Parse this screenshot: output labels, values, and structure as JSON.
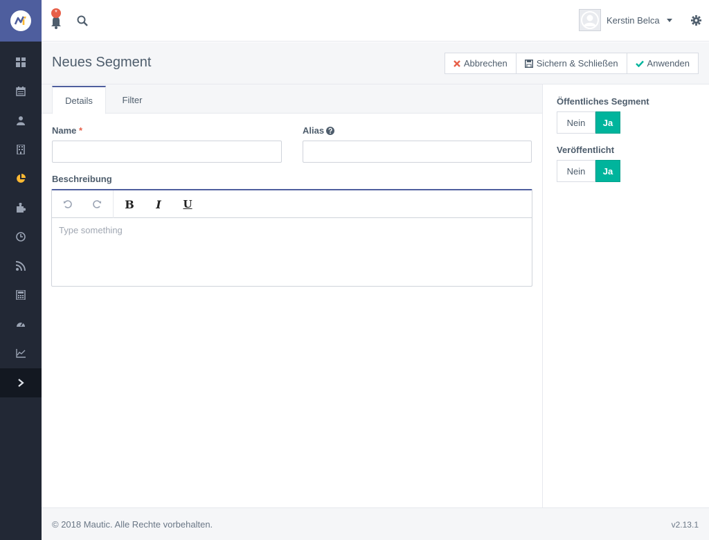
{
  "sidebar": {
    "logo_icon": "mautic-logo-icon",
    "items": [
      {
        "icon": "dashboard-icon"
      },
      {
        "icon": "calendar-icon"
      },
      {
        "icon": "contacts-icon"
      },
      {
        "icon": "companies-icon"
      },
      {
        "icon": "segments-icon",
        "active": true,
        "color": "#fdb933"
      },
      {
        "icon": "components-icon"
      },
      {
        "icon": "campaigns-icon"
      },
      {
        "icon": "channels-icon"
      },
      {
        "icon": "points-icon"
      },
      {
        "icon": "stages-icon"
      },
      {
        "icon": "reports-icon"
      }
    ],
    "expand_icon": "chevron-right-icon"
  },
  "topbar": {
    "notification_badge": "*",
    "user_name": "Kerstin Belca"
  },
  "header": {
    "title": "Neues Segment",
    "buttons": {
      "cancel": "Abbrechen",
      "save_close": "Sichern & Schließen",
      "apply": "Anwenden"
    }
  },
  "tabs": [
    {
      "label": "Details",
      "active": true
    },
    {
      "label": "Filter",
      "active": false
    }
  ],
  "form": {
    "name_label": "Name",
    "name_required": "*",
    "name_value": "",
    "alias_label": "Alias",
    "alias_value": "",
    "description_label": "Beschreibung",
    "editor_placeholder": "Type something",
    "toolbar": {
      "bold": "B",
      "italic": "I",
      "underline": "U"
    }
  },
  "right_panel": {
    "public_label": "Öffentliches Segment",
    "public_no": "Nein",
    "public_yes": "Ja",
    "published_label": "Veröffentlicht",
    "published_no": "Nein",
    "published_yes": "Ja",
    "toggle_active_color": "#00b49c"
  },
  "footer": {
    "copyright": "© 2018 Mautic. Alle Rechte vorbehalten.",
    "version": "v2.13.1"
  }
}
